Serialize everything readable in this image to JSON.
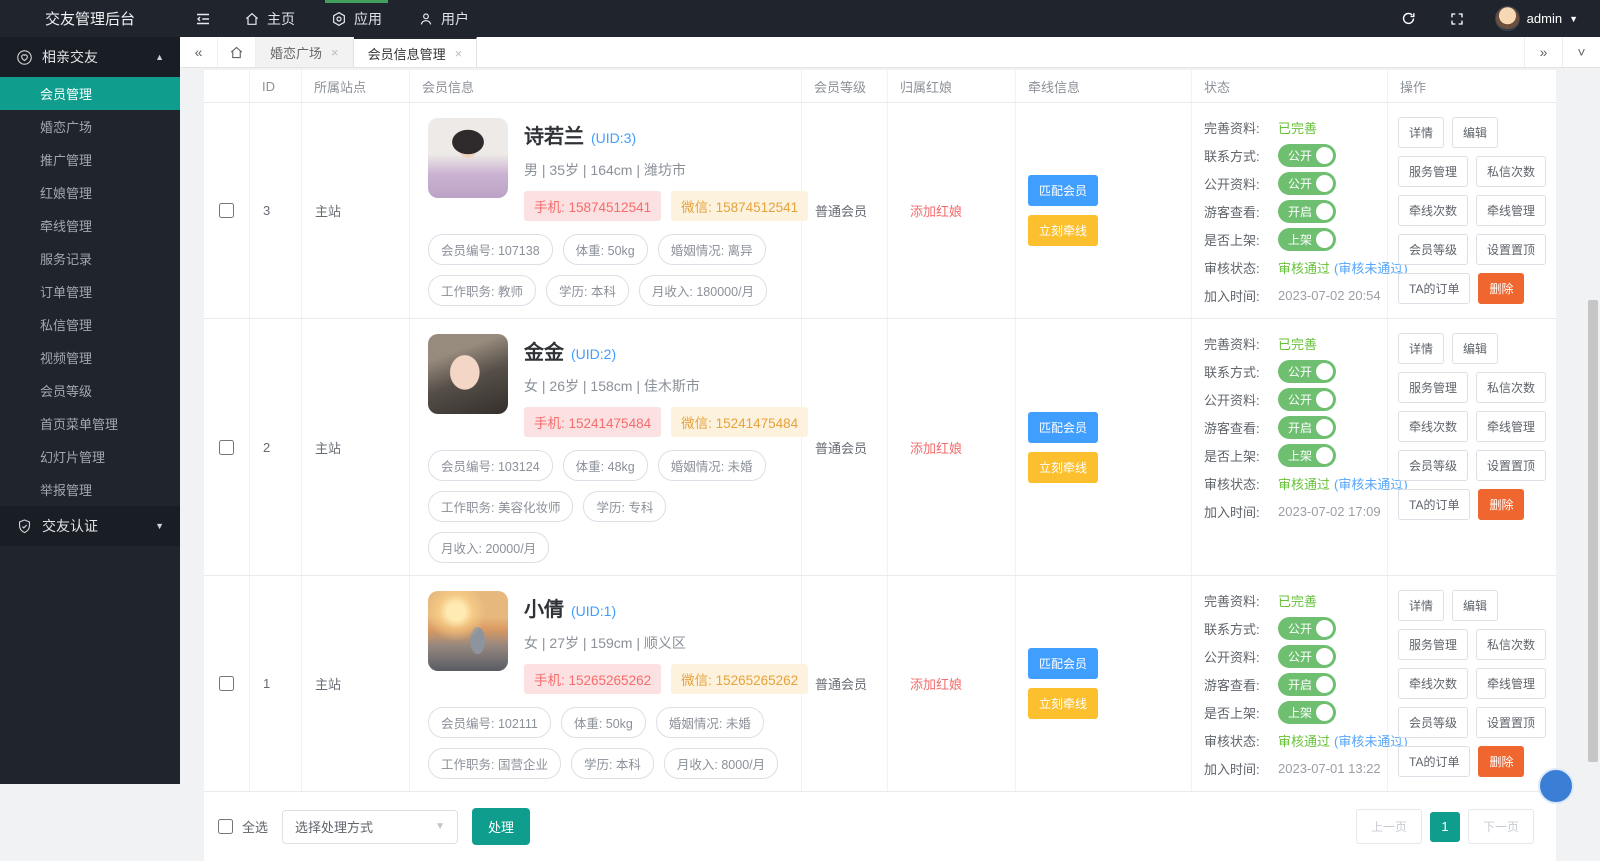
{
  "colors": {
    "accent": "#0f9d8d",
    "topbar_bg": "#20252d",
    "sidebar_bg": "#20242b",
    "section_bg": "#191d24",
    "nav_indicator": "#42a05c",
    "blue": "#409eff",
    "yellow": "#fcbf2e",
    "green": "#67c23a",
    "switch_green": "#6ebf70",
    "red": "#f56c6c",
    "orange_del": "#f0662f",
    "link_blue": "#55a6f8"
  },
  "topbar": {
    "brand": "交友管理后台",
    "nav": [
      {
        "label": "主页"
      },
      {
        "label": "应用"
      },
      {
        "label": "用户"
      }
    ],
    "username": "admin"
  },
  "sidebar": {
    "group1": "相亲交友",
    "items": [
      {
        "label": "会员管理"
      },
      {
        "label": "婚恋广场"
      },
      {
        "label": "推广管理"
      },
      {
        "label": "红娘管理"
      },
      {
        "label": "牵线管理"
      },
      {
        "label": "服务记录"
      },
      {
        "label": "订单管理"
      },
      {
        "label": "私信管理"
      },
      {
        "label": "视频管理"
      },
      {
        "label": "会员等级"
      },
      {
        "label": "首页菜单管理"
      },
      {
        "label": "幻灯片管理"
      },
      {
        "label": "举报管理"
      }
    ],
    "group2": "交友认证"
  },
  "tabs": {
    "tab1": "婚恋广场",
    "tab2": "会员信息管理",
    "close": "×"
  },
  "table": {
    "headers": [
      "",
      "ID",
      "所属站点",
      "会员信息",
      "会员等级",
      "归属红娘",
      "牵线信息",
      "状态",
      "操作"
    ],
    "add_matchmaker": "添加红娘",
    "line_buttons": [
      "匹配会员",
      "立刻牵线"
    ],
    "status_labels": [
      "完善资料:",
      "联系方式:",
      "公开资料:",
      "游客查看:",
      "是否上架:",
      "审核状态:",
      "加入时间:"
    ],
    "status_values": {
      "complete": "已完善",
      "toggle_contact": "公开",
      "toggle_profile": "公开",
      "toggle_guest": "开启",
      "toggle_listed": "上架",
      "audit_pass": "审核通过",
      "audit_fail": "(审核未通过)"
    },
    "action_buttons": [
      "详情",
      "编辑",
      "服务管理",
      "私信次数",
      "牵线次数",
      "牵线管理",
      "会员等级",
      "设置置顶",
      "TA的订单",
      "删除"
    ],
    "rows": [
      {
        "id": "3",
        "site": "主站",
        "name": "诗若兰",
        "uid": "(UID:3)",
        "meta": "男 | 35岁 | 164cm | 潍坊市",
        "phone": "手机: 15874512541",
        "wechat": "微信: 15874512541",
        "tags": [
          "会员编号: 107138",
          "体重: 50kg",
          "婚姻情况: 离异",
          "工作职务: 教师",
          "学历: 本科",
          "月收入: 180000/月"
        ],
        "level": "普通会员",
        "join_time": "2023-07-02 20:54"
      },
      {
        "id": "2",
        "site": "主站",
        "name": "金金",
        "uid": "(UID:2)",
        "meta": "女 | 26岁 | 158cm | 佳木斯市",
        "phone": "手机: 15241475484",
        "wechat": "微信: 15241475484",
        "tags": [
          "会员编号: 103124",
          "体重: 48kg",
          "婚姻情况: 未婚",
          "工作职务: 美容化妆师",
          "学历: 专科",
          "月收入: 20000/月"
        ],
        "level": "普通会员",
        "join_time": "2023-07-02 17:09"
      },
      {
        "id": "1",
        "site": "主站",
        "name": "小倩",
        "uid": "(UID:1)",
        "meta": "女 | 27岁 | 159cm | 顺义区",
        "phone": "手机: 15265265262",
        "wechat": "微信: 15265265262",
        "tags": [
          "会员编号: 102111",
          "体重: 50kg",
          "婚姻情况: 未婚",
          "工作职务: 国营企业",
          "学历: 本科",
          "月收入: 8000/月"
        ],
        "level": "普通会员",
        "join_time": "2023-07-01 13:22"
      }
    ]
  },
  "toolbar": {
    "select_all": "全选",
    "mode_placeholder": "选择处理方式",
    "process": "处理"
  },
  "pagination": {
    "prev": "上一页",
    "current": "1",
    "next": "下一页"
  }
}
